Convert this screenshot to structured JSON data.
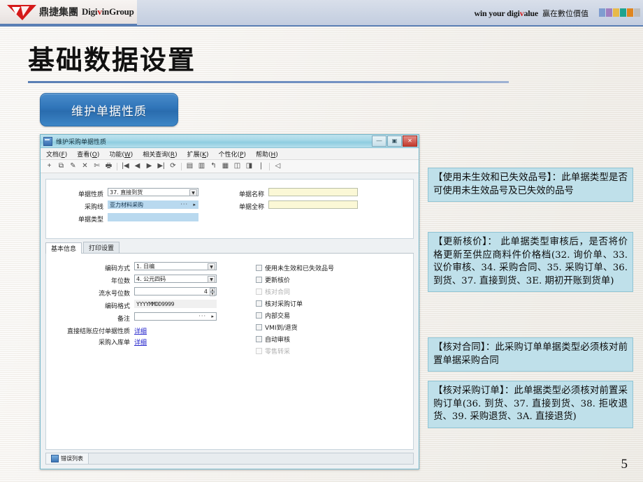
{
  "banner": {
    "logo_cn": "鼎捷集團",
    "logo_en_pre": "Digi",
    "logo_en_v": "v",
    "logo_en_post": "inGroup",
    "tagline_en_pre": "win your digi",
    "tagline_en_v": "v",
    "tagline_en_post": "alue",
    "tagline_cn": "贏在數位價值",
    "swatch_colors": [
      "#7f9dd0",
      "#a07fc0",
      "#e8b949",
      "#1fa38f",
      "#e0861f",
      "#bdbdbd"
    ]
  },
  "slide": {
    "title": "基础数据设置",
    "pill_label": "维护单据性质",
    "page_number": "5",
    "accent_color": "#2f74b8",
    "rule_color": "#5a7fb5"
  },
  "window": {
    "title": "维护采购单据性质",
    "controls": {
      "minimize": "—",
      "maximize": "▣",
      "close": "✕"
    },
    "menus": [
      {
        "label": "文档",
        "accel": "F"
      },
      {
        "label": "查看",
        "accel": "O"
      },
      {
        "label": "功能",
        "accel": "W"
      },
      {
        "label": "相关查询",
        "accel": "R"
      },
      {
        "label": "扩展",
        "accel": "K"
      },
      {
        "label": "个性化",
        "accel": "P"
      },
      {
        "label": "帮助",
        "accel": "H"
      }
    ],
    "toolbar_icons": [
      "add-icon",
      "copy-icon",
      "edit-icon",
      "delete-icon",
      "cut-icon",
      "print-icon",
      "sep",
      "first-record-icon",
      "prev-record-icon",
      "next-record-icon",
      "last-record-icon",
      "refresh-icon",
      "sep",
      "save-icon",
      "open-icon",
      "undo-icon",
      "post-icon",
      "unpost-icon",
      "approve-icon",
      "attach-icon",
      "sep",
      "check-icon"
    ],
    "status_bar": {
      "error_list_label": "错误列表",
      "error_list_icon": "error-list-icon"
    }
  },
  "header_form": {
    "fields": [
      {
        "label": "单据性质",
        "value": "37. 直接到货",
        "type": "combo"
      },
      {
        "label": "采购线",
        "value": "亚力材料采购",
        "type": "lookup"
      },
      {
        "label": "单据类型",
        "value": "",
        "type": "readonly"
      },
      {
        "label": "单据名称",
        "value": "",
        "type": "text"
      },
      {
        "label": "单据全称",
        "value": "",
        "type": "text"
      }
    ]
  },
  "tabs": [
    {
      "label": "基本信息",
      "active": true
    },
    {
      "label": "打印设置",
      "active": false
    }
  ],
  "main_form": {
    "fields": [
      {
        "label": "编码方式",
        "value": "1. 日编",
        "type": "combo"
      },
      {
        "label": "年位数",
        "value": "4. 公元四码",
        "type": "combo"
      },
      {
        "label": "流水号位数",
        "value": "4",
        "type": "spinner"
      },
      {
        "label": "编码格式",
        "value": "YYYYMMDD9999",
        "type": "readonly"
      },
      {
        "label": "备注",
        "value": "",
        "type": "lookup"
      }
    ],
    "links": [
      {
        "label": "直接结账应付单据性质",
        "link_text": "详细"
      },
      {
        "label": "采购入库单",
        "link_text": "详细"
      }
    ],
    "checkboxes": [
      {
        "label": "使用未生效和已失效品号",
        "checked": false,
        "disabled": false
      },
      {
        "label": "更新核价",
        "checked": false,
        "disabled": false
      },
      {
        "label": "核对合同",
        "checked": false,
        "disabled": true
      },
      {
        "label": "核对采购订单",
        "checked": false,
        "disabled": false
      },
      {
        "label": "内部交易",
        "checked": false,
        "disabled": false
      },
      {
        "label": "VMI到/退货",
        "checked": false,
        "disabled": false
      },
      {
        "label": "自动审核",
        "checked": false,
        "disabled": false
      },
      {
        "label": "零售转采",
        "checked": false,
        "disabled": true
      }
    ]
  },
  "notes": [
    {
      "text": "【使用未生效和已失效品号】：此单据类型是否可使用未生效品号及已失效的品号"
    },
    {
      "text": "【更新核价】： 此单据类型审核后，是否将价格更新至供应商料件价格档(32. 询价单、33. 议价审核、34. 采购合同、35. 采购订单、36. 到货、37. 直接到货、3E. 期初开账到货单)"
    },
    {
      "text": "【核对合同】：此采购订单单据类型必须核对前置单据采购合同"
    },
    {
      "text": "【核对采购订单】：此单据类型必须核对前置采购订单(36. 到货、37. 直接到货、38. 拒收退货、39. 采购退货、3A. 直接退货)"
    }
  ]
}
